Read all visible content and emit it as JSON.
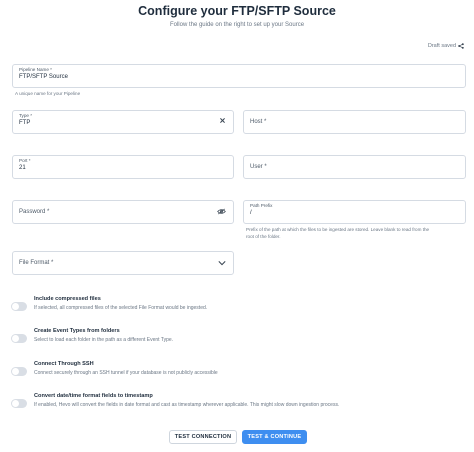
{
  "header": {
    "title": "Configure your FTP/SFTP Source",
    "subtitle": "Follow the guide on the right to set up your Source"
  },
  "draft": {
    "label": "Draft saved",
    "icon": "share-icon"
  },
  "form": {
    "pipeline_name": {
      "label": "Pipeline Name *",
      "value": "FTP/SFTP Source",
      "hint": "A unique name for your Pipeline"
    },
    "type": {
      "label": "Type *",
      "value": "FTP",
      "clear_icon": "close-icon"
    },
    "host": {
      "placeholder": "Host *"
    },
    "port": {
      "label": "Port *",
      "value": "21"
    },
    "user": {
      "placeholder": "User *"
    },
    "password": {
      "placeholder": "Password *",
      "icon": "eye-off-icon"
    },
    "path_prefix": {
      "label": "Path Prefix",
      "value": "/",
      "hint_line1": "Prefix of the path at which the files to be ingested are stored. Leave blank to read from the",
      "hint_line2": "root of the folder."
    },
    "file_format": {
      "placeholder": "File Format *",
      "icon": "chevron-down-icon"
    }
  },
  "toggles": [
    {
      "title": "Include compressed files",
      "desc": "If selected, all compressed files of the selected File Format would be ingested.",
      "enabled": false
    },
    {
      "title": "Create Event Types from folders",
      "desc": "Select to load each folder in the path as a different Event Type.",
      "enabled": false
    },
    {
      "title": "Connect Through SSH",
      "desc": "Connect securely through an SSH tunnel if your database is not publicly accessible",
      "enabled": false
    },
    {
      "title": "Convert date/time format fields to timestamp",
      "desc": "If enabled, Hevo will convert the fields in date format and cast as timestamp wherever applicable. This might slow down ingestion process.",
      "enabled": false
    }
  ],
  "buttons": {
    "test_connection": "TEST CONNECTION",
    "test_continue": "TEST & CONTINUE"
  },
  "colors": {
    "primary": "#3e8ef0",
    "toggle_off": "#d9dee5",
    "border": "#d5dbe3"
  }
}
